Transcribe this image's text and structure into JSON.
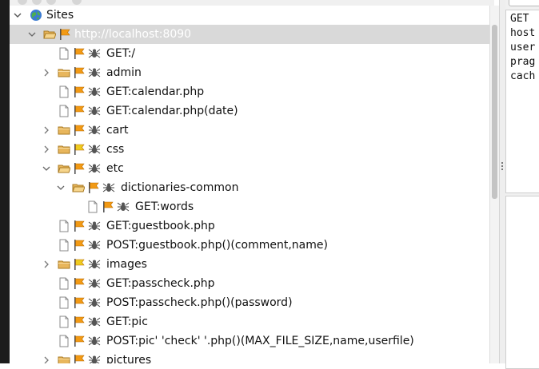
{
  "tree": {
    "root": {
      "label": "Sites",
      "icon": "globe-icon"
    },
    "nodes": [
      {
        "label": "http://localhost:8090",
        "type": "folder-open",
        "expander": "down",
        "selected": true,
        "flag": "orange",
        "spider": false
      },
      {
        "label": "GET:/",
        "type": "file",
        "expander": "",
        "flag": "orange",
        "spider": true
      },
      {
        "label": "admin",
        "type": "folder",
        "expander": "right",
        "flag": "orange",
        "spider": true
      },
      {
        "label": "GET:calendar.php",
        "type": "file",
        "expander": "",
        "flag": "orange",
        "spider": true
      },
      {
        "label": "GET:calendar.php(date)",
        "type": "file",
        "expander": "",
        "flag": "orange",
        "spider": true
      },
      {
        "label": "cart",
        "type": "folder",
        "expander": "right",
        "flag": "orange",
        "spider": true
      },
      {
        "label": "css",
        "type": "folder",
        "expander": "right",
        "flag": "yellow",
        "spider": true
      },
      {
        "label": "etc",
        "type": "folder-open",
        "expander": "down",
        "flag": "orange",
        "spider": true
      },
      {
        "label": "dictionaries-common",
        "type": "folder-open",
        "expander": "down",
        "flag": "orange",
        "spider": true
      },
      {
        "label": "GET:words",
        "type": "file",
        "expander": "",
        "flag": "orange",
        "spider": true
      },
      {
        "label": "GET:guestbook.php",
        "type": "file",
        "expander": "",
        "flag": "orange",
        "spider": true
      },
      {
        "label": "POST:guestbook.php()(comment,name)",
        "type": "file",
        "expander": "",
        "flag": "orange",
        "spider": true
      },
      {
        "label": "images",
        "type": "folder",
        "expander": "right",
        "flag": "yellow",
        "spider": true
      },
      {
        "label": "GET:passcheck.php",
        "type": "file",
        "expander": "",
        "flag": "orange",
        "spider": true
      },
      {
        "label": "POST:passcheck.php()(password)",
        "type": "file",
        "expander": "",
        "flag": "orange",
        "spider": true
      },
      {
        "label": "GET:pic",
        "type": "file",
        "expander": "",
        "flag": "orange",
        "spider": true
      },
      {
        "label": "POST:pic'    'check'    '.php()(MAX_FILE_SIZE,name,userfile)",
        "type": "file",
        "expander": "",
        "flag": "orange",
        "spider": true
      },
      {
        "label": "pictures",
        "type": "folder",
        "expander": "right",
        "flag": "orange",
        "spider": true
      }
    ]
  },
  "request_panel": {
    "lines": [
      "GET",
      "host",
      "user",
      "prag",
      "cach"
    ]
  },
  "colors": {
    "selection": "#d9d9d9",
    "flag_orange": "#f29a14",
    "flag_yellow": "#eecb1f",
    "folder": "#e8b65c"
  }
}
